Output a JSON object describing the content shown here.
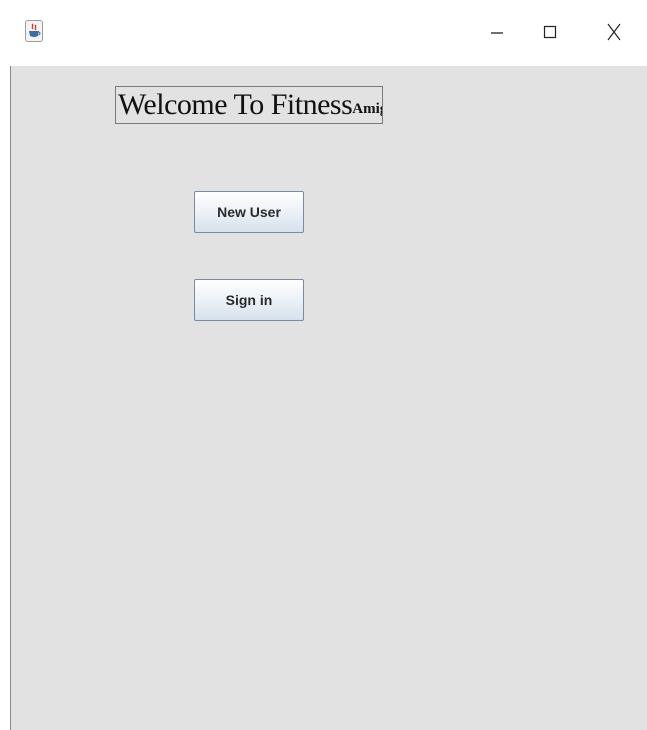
{
  "window": {
    "icon": "java-cup-icon",
    "controls": {
      "minimize": "–",
      "maximize": "☐",
      "close": "X"
    }
  },
  "content": {
    "welcome_main": "Welcome To Fitness",
    "welcome_suffix": "Amigo",
    "new_user_label": "New User",
    "sign_in_label": "Sign in"
  },
  "colors": {
    "background": "#e2e2e2",
    "button_border": "#7a8aa0"
  }
}
